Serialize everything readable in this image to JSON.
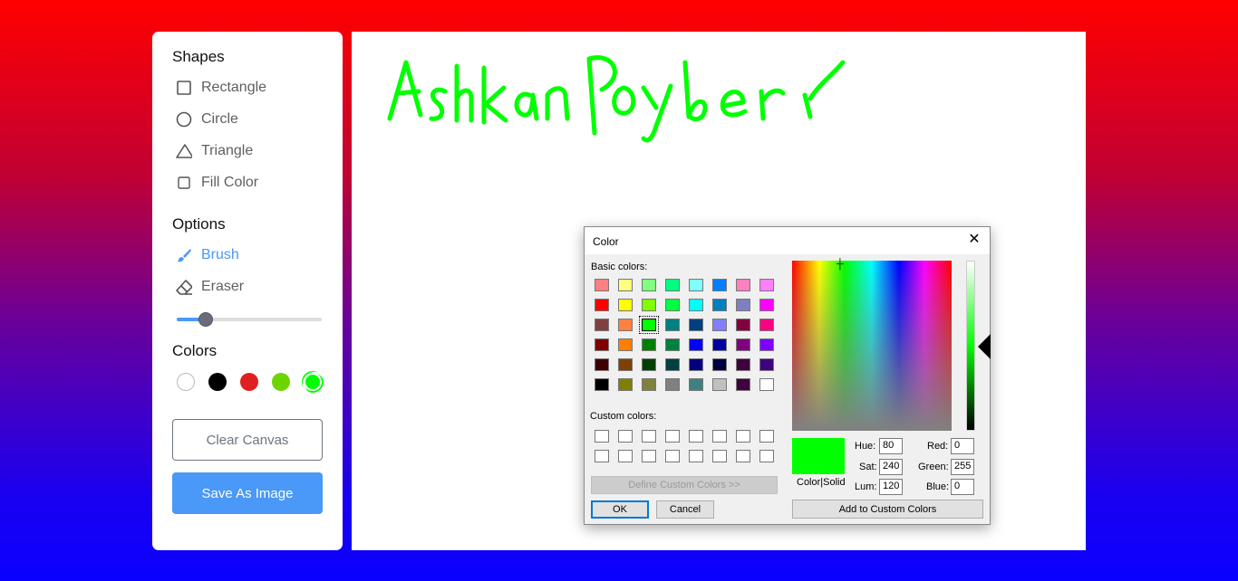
{
  "sidebar": {
    "shapes_title": "Shapes",
    "shapes": [
      {
        "label": "Rectangle",
        "icon": "square-icon"
      },
      {
        "label": "Circle",
        "icon": "circle-icon"
      },
      {
        "label": "Triangle",
        "icon": "triangle-icon"
      },
      {
        "label": "Fill Color",
        "icon": "checkbox-icon"
      }
    ],
    "options_title": "Options",
    "options": [
      {
        "label": "Brush",
        "icon": "brush-icon",
        "active": true
      },
      {
        "label": "Eraser",
        "icon": "eraser-icon",
        "active": false
      }
    ],
    "brush_size_fraction": 0.2,
    "colors_title": "Colors",
    "colors": [
      "#ffffff",
      "#000000",
      "#e02020",
      "#6dd400",
      "#00ff00"
    ],
    "selected_color_index": 4,
    "clear_label": "Clear Canvas",
    "save_label": "Save As Image"
  },
  "canvas": {
    "handwriting": "Ashkan Poyber",
    "stroke_color": "#00ff00"
  },
  "dialog": {
    "title": "Color",
    "basic_colors_label": "Basic colors:",
    "basic_colors": [
      [
        "#ff8080",
        "#ffff80",
        "#80ff80",
        "#00ff80",
        "#80ffff",
        "#0080ff",
        "#ff80c0",
        "#ff80ff"
      ],
      [
        "#ff0000",
        "#ffff00",
        "#80ff00",
        "#00ff40",
        "#00ffff",
        "#0080c0",
        "#8080c0",
        "#ff00ff"
      ],
      [
        "#804040",
        "#ff8040",
        "#00ff00",
        "#008080",
        "#004080",
        "#8080ff",
        "#800040",
        "#ff0080"
      ],
      [
        "#800000",
        "#ff8000",
        "#008000",
        "#008040",
        "#0000ff",
        "#0000a0",
        "#800080",
        "#8000ff"
      ],
      [
        "#400000",
        "#804000",
        "#004000",
        "#004040",
        "#000080",
        "#000040",
        "#400040",
        "#400080"
      ],
      [
        "#000000",
        "#808000",
        "#808040",
        "#808080",
        "#408080",
        "#c0c0c0",
        "#400040",
        "#ffffff"
      ]
    ],
    "selected_basic": [
      2,
      2
    ],
    "custom_colors_label": "Custom colors:",
    "define_custom_label": "Define Custom Colors >>",
    "ok_label": "OK",
    "cancel_label": "Cancel",
    "preview_label": "Color|Solid",
    "hue_label": "Hue:",
    "hue": "80",
    "sat_label": "Sat:",
    "sat": "240",
    "lum_label": "Lum:",
    "lum": "120",
    "red_label": "Red:",
    "red": "0",
    "green_label": "Green:",
    "green": "255",
    "blue_label": "Blue:",
    "blue": "0",
    "add_custom_label": "Add to Custom Colors"
  }
}
